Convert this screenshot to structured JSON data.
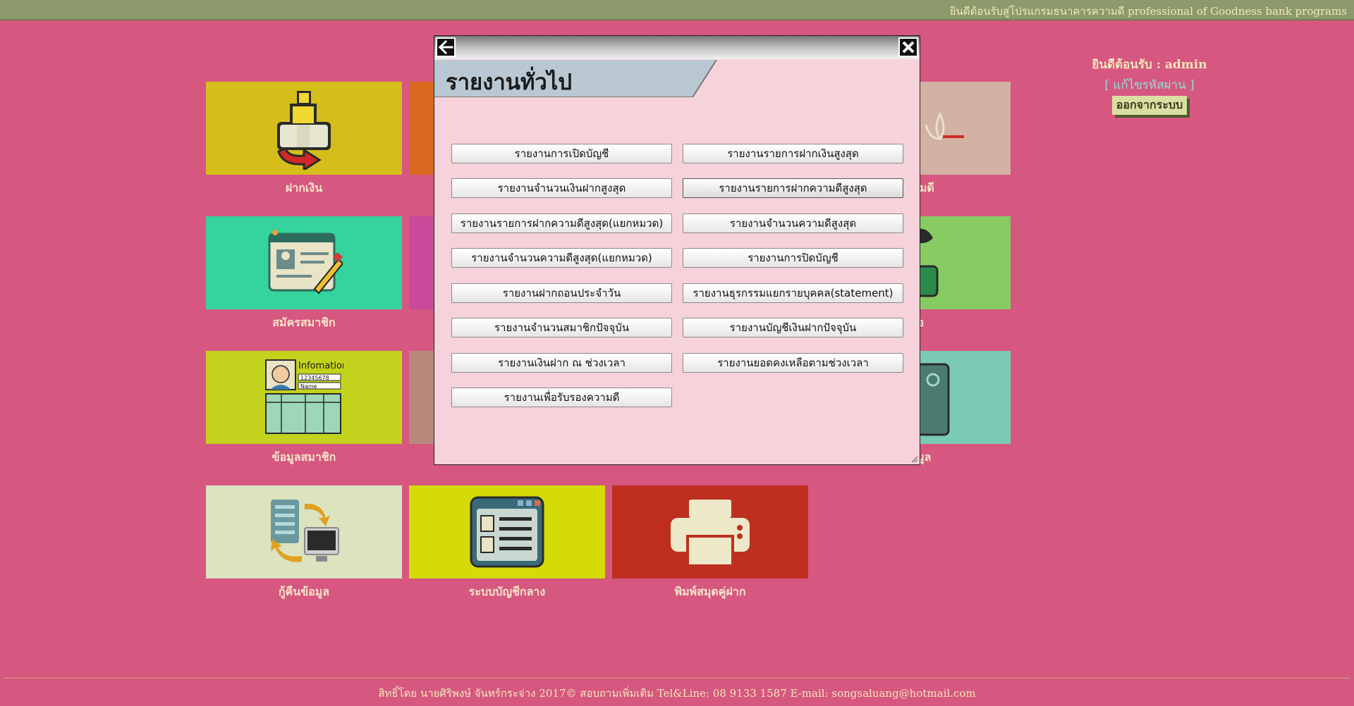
{
  "topbar": {
    "message": "ยินดีต้อนรับสู่โปรแกรมธนาคารความดี professional of Goodness bank programs"
  },
  "user": {
    "welcome": "ยินดีต้อนรับ : admin",
    "change_password": "[ แก้ไขรหัสผ่าน ]",
    "logout": "ออกจากระบบ"
  },
  "tiles": [
    {
      "label": "ฝากเงิน",
      "color": "#d5bd1b",
      "icon": "money-deposit-icon"
    },
    {
      "label": "",
      "color": "#d8691e",
      "icon": ""
    },
    {
      "label": "ความดี",
      "color": "#d3b2a3",
      "icon": "lotus-icon"
    },
    {
      "label": "สมัครสมาชิก",
      "color": "#35d39e",
      "icon": "register-card-icon"
    },
    {
      "label": "",
      "color": "#c94a9a",
      "icon": ""
    },
    {
      "label": "ชื่อ",
      "color": "#86cc62",
      "icon": "person-icon"
    },
    {
      "label": "ข้อมูลสมาชิก",
      "color": "#c3d31d",
      "icon": "member-info-icon",
      "icon_text": [
        "Infomation",
        "12345678",
        "Name"
      ]
    },
    {
      "label": "",
      "color": "#b88a7e",
      "icon": ""
    },
    {
      "label": "ข้อมูล",
      "color": "#7bcab4",
      "icon": "database-icon"
    },
    {
      "label": "กู้คืนข้อมูล",
      "color": "#dce3be",
      "icon": "restore-data-icon"
    },
    {
      "label": "ระบบบัญชีกลาง",
      "color": "#d4db06",
      "icon": "central-ledger-icon"
    },
    {
      "label": "พิมพ์สมุดคู่ฝาก",
      "color": "#be2f20",
      "icon": "printer-icon"
    }
  ],
  "modal": {
    "title": "รายงานทั่วไป",
    "buttons_left": [
      "รายงานการเปิดบัญชี",
      "รายงานจำนวนเงินฝากสูงสุด",
      "รายงานรายการฝากความดีสูงสุด(แยกหมวด)",
      "รายงานจำนวนความดีสูงสุด(แยกหมวด)",
      "รายงานฝากถอนประจำวัน",
      "รายงานจำนวนสมาชิกปัจจุบัน",
      "รายงานเงินฝาก ณ ช่วงเวลา",
      "รายงานเพื่อรับรองความดี"
    ],
    "buttons_right": [
      "รายงานรายการฝากเงินสูงสุด",
      "รายงานรายการฝากความดีสูงสุด",
      "รายงานจำนวนความดีสูงสุด",
      "รายงานการปิดบัญชี",
      "รายงานธุรกรรมแยกรายบุคคล(statement)",
      "รายงานบัญชีเงินฝากปัจจุบัน",
      "รายงานยอดคงเหลือตามช่วงเวลา"
    ]
  },
  "footer": {
    "text": "สิทธิ์โดย นายศิริพงษ์ จันทร์กระจ่าง 2017© สอบถามเพิ่มเติม Tel&Line: 08 9133 1587 E-mail: songsaluang@hotmail.com"
  }
}
